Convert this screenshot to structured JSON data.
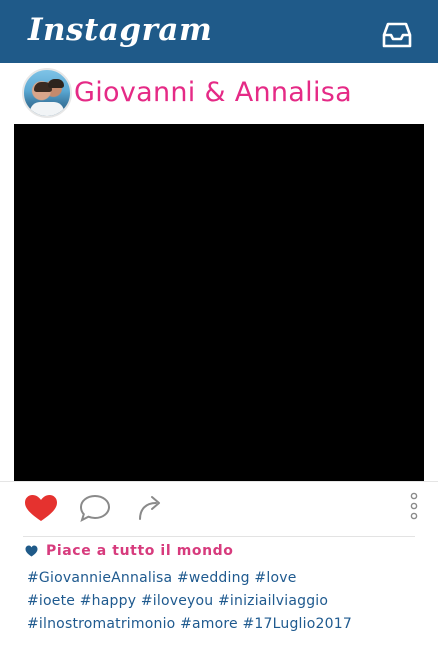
{
  "app": {
    "title": "Instagram",
    "accent": "#1f5a89"
  },
  "post": {
    "username": "Giovanni & Annalisa",
    "username_color": "#e52a86",
    "likes_text": "Piace a tutto il mondo",
    "caption_lines": [
      "#GiovannieAnnalisa #wedding #love",
      "#ioete #happy #iloveyou #iniziailviaggio",
      "#ilnostromatrimonio #amore #17Luglio2017"
    ],
    "liked": true
  },
  "icons": {
    "inbox": "inbox-icon",
    "like": "heart-icon",
    "comment": "comment-icon",
    "share": "share-icon",
    "more": "more-options-icon"
  }
}
